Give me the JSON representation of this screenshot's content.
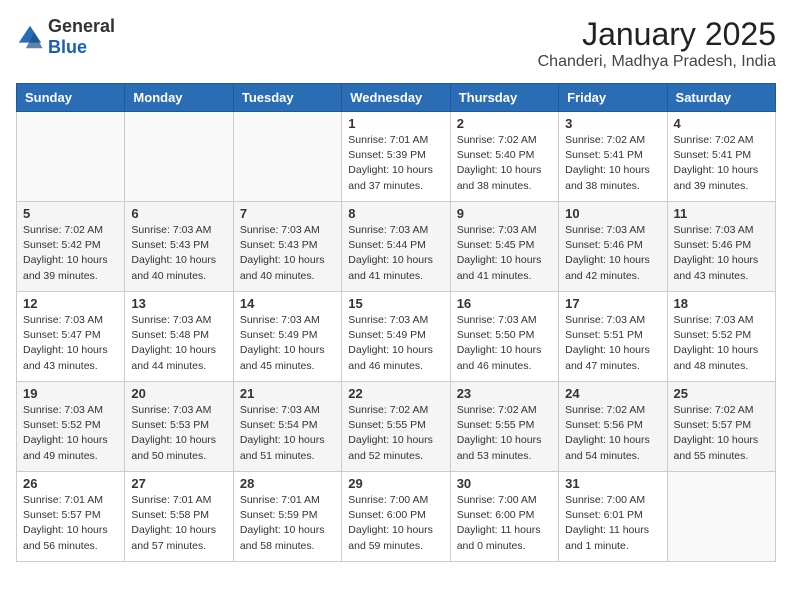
{
  "logo": {
    "general": "General",
    "blue": "Blue"
  },
  "header": {
    "month": "January 2025",
    "location": "Chanderi, Madhya Pradesh, India"
  },
  "weekdays": [
    "Sunday",
    "Monday",
    "Tuesday",
    "Wednesday",
    "Thursday",
    "Friday",
    "Saturday"
  ],
  "weeks": [
    [
      {
        "day": "",
        "sunrise": "",
        "sunset": "",
        "daylight": ""
      },
      {
        "day": "",
        "sunrise": "",
        "sunset": "",
        "daylight": ""
      },
      {
        "day": "",
        "sunrise": "",
        "sunset": "",
        "daylight": ""
      },
      {
        "day": "1",
        "sunrise": "Sunrise: 7:01 AM",
        "sunset": "Sunset: 5:39 PM",
        "daylight": "Daylight: 10 hours and 37 minutes."
      },
      {
        "day": "2",
        "sunrise": "Sunrise: 7:02 AM",
        "sunset": "Sunset: 5:40 PM",
        "daylight": "Daylight: 10 hours and 38 minutes."
      },
      {
        "day": "3",
        "sunrise": "Sunrise: 7:02 AM",
        "sunset": "Sunset: 5:41 PM",
        "daylight": "Daylight: 10 hours and 38 minutes."
      },
      {
        "day": "4",
        "sunrise": "Sunrise: 7:02 AM",
        "sunset": "Sunset: 5:41 PM",
        "daylight": "Daylight: 10 hours and 39 minutes."
      }
    ],
    [
      {
        "day": "5",
        "sunrise": "Sunrise: 7:02 AM",
        "sunset": "Sunset: 5:42 PM",
        "daylight": "Daylight: 10 hours and 39 minutes."
      },
      {
        "day": "6",
        "sunrise": "Sunrise: 7:03 AM",
        "sunset": "Sunset: 5:43 PM",
        "daylight": "Daylight: 10 hours and 40 minutes."
      },
      {
        "day": "7",
        "sunrise": "Sunrise: 7:03 AM",
        "sunset": "Sunset: 5:43 PM",
        "daylight": "Daylight: 10 hours and 40 minutes."
      },
      {
        "day": "8",
        "sunrise": "Sunrise: 7:03 AM",
        "sunset": "Sunset: 5:44 PM",
        "daylight": "Daylight: 10 hours and 41 minutes."
      },
      {
        "day": "9",
        "sunrise": "Sunrise: 7:03 AM",
        "sunset": "Sunset: 5:45 PM",
        "daylight": "Daylight: 10 hours and 41 minutes."
      },
      {
        "day": "10",
        "sunrise": "Sunrise: 7:03 AM",
        "sunset": "Sunset: 5:46 PM",
        "daylight": "Daylight: 10 hours and 42 minutes."
      },
      {
        "day": "11",
        "sunrise": "Sunrise: 7:03 AM",
        "sunset": "Sunset: 5:46 PM",
        "daylight": "Daylight: 10 hours and 43 minutes."
      }
    ],
    [
      {
        "day": "12",
        "sunrise": "Sunrise: 7:03 AM",
        "sunset": "Sunset: 5:47 PM",
        "daylight": "Daylight: 10 hours and 43 minutes."
      },
      {
        "day": "13",
        "sunrise": "Sunrise: 7:03 AM",
        "sunset": "Sunset: 5:48 PM",
        "daylight": "Daylight: 10 hours and 44 minutes."
      },
      {
        "day": "14",
        "sunrise": "Sunrise: 7:03 AM",
        "sunset": "Sunset: 5:49 PM",
        "daylight": "Daylight: 10 hours and 45 minutes."
      },
      {
        "day": "15",
        "sunrise": "Sunrise: 7:03 AM",
        "sunset": "Sunset: 5:49 PM",
        "daylight": "Daylight: 10 hours and 46 minutes."
      },
      {
        "day": "16",
        "sunrise": "Sunrise: 7:03 AM",
        "sunset": "Sunset: 5:50 PM",
        "daylight": "Daylight: 10 hours and 46 minutes."
      },
      {
        "day": "17",
        "sunrise": "Sunrise: 7:03 AM",
        "sunset": "Sunset: 5:51 PM",
        "daylight": "Daylight: 10 hours and 47 minutes."
      },
      {
        "day": "18",
        "sunrise": "Sunrise: 7:03 AM",
        "sunset": "Sunset: 5:52 PM",
        "daylight": "Daylight: 10 hours and 48 minutes."
      }
    ],
    [
      {
        "day": "19",
        "sunrise": "Sunrise: 7:03 AM",
        "sunset": "Sunset: 5:52 PM",
        "daylight": "Daylight: 10 hours and 49 minutes."
      },
      {
        "day": "20",
        "sunrise": "Sunrise: 7:03 AM",
        "sunset": "Sunset: 5:53 PM",
        "daylight": "Daylight: 10 hours and 50 minutes."
      },
      {
        "day": "21",
        "sunrise": "Sunrise: 7:03 AM",
        "sunset": "Sunset: 5:54 PM",
        "daylight": "Daylight: 10 hours and 51 minutes."
      },
      {
        "day": "22",
        "sunrise": "Sunrise: 7:02 AM",
        "sunset": "Sunset: 5:55 PM",
        "daylight": "Daylight: 10 hours and 52 minutes."
      },
      {
        "day": "23",
        "sunrise": "Sunrise: 7:02 AM",
        "sunset": "Sunset: 5:55 PM",
        "daylight": "Daylight: 10 hours and 53 minutes."
      },
      {
        "day": "24",
        "sunrise": "Sunrise: 7:02 AM",
        "sunset": "Sunset: 5:56 PM",
        "daylight": "Daylight: 10 hours and 54 minutes."
      },
      {
        "day": "25",
        "sunrise": "Sunrise: 7:02 AM",
        "sunset": "Sunset: 5:57 PM",
        "daylight": "Daylight: 10 hours and 55 minutes."
      }
    ],
    [
      {
        "day": "26",
        "sunrise": "Sunrise: 7:01 AM",
        "sunset": "Sunset: 5:57 PM",
        "daylight": "Daylight: 10 hours and 56 minutes."
      },
      {
        "day": "27",
        "sunrise": "Sunrise: 7:01 AM",
        "sunset": "Sunset: 5:58 PM",
        "daylight": "Daylight: 10 hours and 57 minutes."
      },
      {
        "day": "28",
        "sunrise": "Sunrise: 7:01 AM",
        "sunset": "Sunset: 5:59 PM",
        "daylight": "Daylight: 10 hours and 58 minutes."
      },
      {
        "day": "29",
        "sunrise": "Sunrise: 7:00 AM",
        "sunset": "Sunset: 6:00 PM",
        "daylight": "Daylight: 10 hours and 59 minutes."
      },
      {
        "day": "30",
        "sunrise": "Sunrise: 7:00 AM",
        "sunset": "Sunset: 6:00 PM",
        "daylight": "Daylight: 11 hours and 0 minutes."
      },
      {
        "day": "31",
        "sunrise": "Sunrise: 7:00 AM",
        "sunset": "Sunset: 6:01 PM",
        "daylight": "Daylight: 11 hours and 1 minute."
      },
      {
        "day": "",
        "sunrise": "",
        "sunset": "",
        "daylight": ""
      }
    ]
  ]
}
